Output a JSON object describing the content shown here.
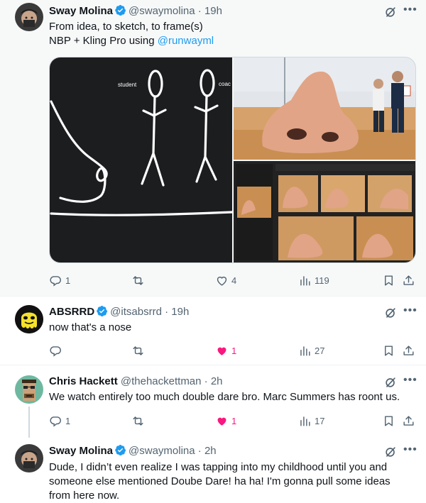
{
  "tweet1": {
    "name": "Sway Molina",
    "handle": "@swaymolina",
    "time": "· 19h",
    "line1": "From idea, to sketch, to frame(s)",
    "line2_prefix": "NBP + Kling Pro using ",
    "line2_mention": "@runwayml",
    "sketch_label_student": "student",
    "sketch_label_coach": "coac",
    "replies": "1",
    "retweets": "",
    "likes": "4",
    "views": "119"
  },
  "tweet2": {
    "name": "ABSRRD",
    "handle": "@itsabsrrd",
    "time": "· 19h",
    "text": "now that's a nose",
    "replies": "",
    "retweets": "",
    "likes": "1",
    "views": "27"
  },
  "tweet3": {
    "name": "Chris Hackett",
    "handle": "@thehackettman",
    "time": "· 2h",
    "text": "We watch entirely too much double dare bro. Marc Summers has roont us.",
    "replies": "1",
    "retweets": "",
    "likes": "1",
    "views": "17"
  },
  "tweet4": {
    "name": "Sway Molina",
    "handle": "@swaymolina",
    "time": "· 2h",
    "line1": "Dude, I didn’t even realize I was tapping into my childhood until you and",
    "line2": "someone else mentioned Doube Dare! ha ha! I'm gonna pull some ideas",
    "line3": "from here now."
  },
  "colors": {
    "accent": "#1d9bf0",
    "like": "#f91880",
    "muted": "#536471",
    "highlight_bg": "#f7f9f9"
  },
  "icons": [
    "verified-icon",
    "grok-icon",
    "more-icon",
    "reply-icon",
    "retweet-icon",
    "like-icon",
    "views-icon",
    "bookmark-icon",
    "share-icon"
  ]
}
